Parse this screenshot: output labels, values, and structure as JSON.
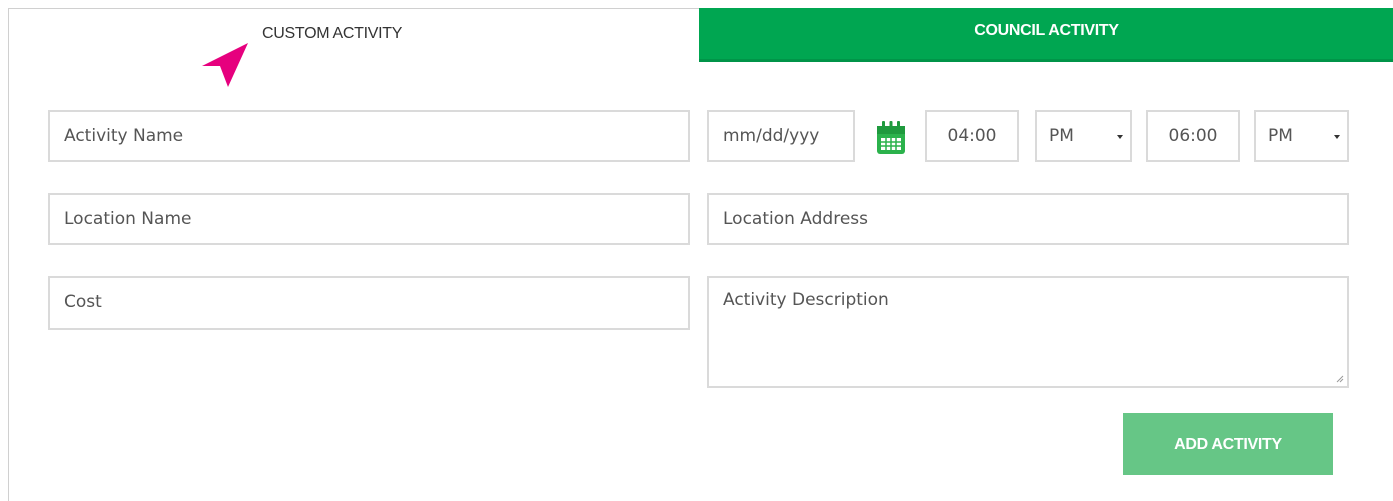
{
  "tabs": {
    "custom_label": "CUSTOM ACTIVITY",
    "council_label": "COUNCIL ACTIVITY"
  },
  "form": {
    "activity_name_placeholder": "Activity Name",
    "date_placeholder": "mm/dd/yyy",
    "start_time": "04:00",
    "start_ampm": "PM",
    "end_time": "06:00",
    "end_ampm": "PM",
    "location_name_placeholder": "Location Name",
    "location_address_placeholder": "Location Address",
    "cost_placeholder": "Cost",
    "description_placeholder": "Activity Description",
    "add_button_label": "ADD ACTIVITY"
  },
  "icons": {
    "calendar": "calendar-icon",
    "pointer": "pointer-arrow-icon"
  },
  "colors": {
    "accent_green": "#00a651",
    "button_green": "#66c686",
    "pointer_pink": "#e6007e"
  }
}
